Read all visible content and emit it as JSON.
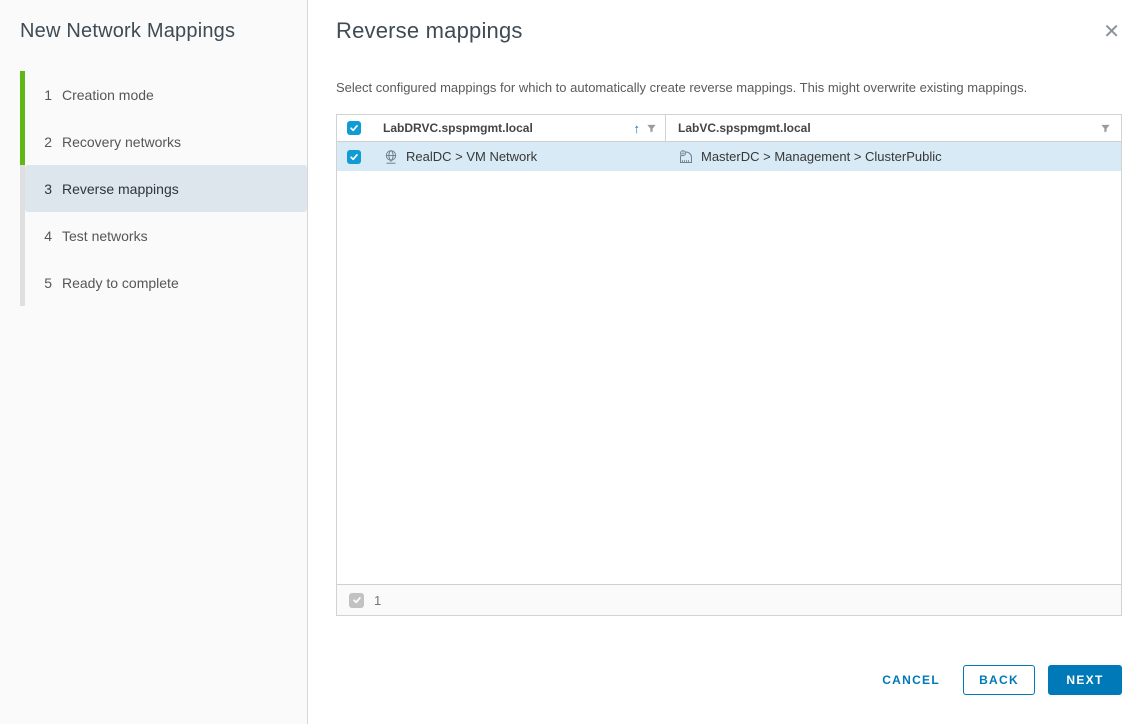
{
  "wizard": {
    "title": "New Network Mappings",
    "steps": [
      {
        "number": "1",
        "label": "Creation mode",
        "state": "completed"
      },
      {
        "number": "2",
        "label": "Recovery networks",
        "state": "completed"
      },
      {
        "number": "3",
        "label": "Reverse mappings",
        "state": "active"
      },
      {
        "number": "4",
        "label": "Test networks",
        "state": "upcoming"
      },
      {
        "number": "5",
        "label": "Ready to complete",
        "state": "upcoming"
      }
    ]
  },
  "panel": {
    "title": "Reverse mappings",
    "description": "Select configured mappings for which to automatically create reverse mappings. This might overwrite existing mappings."
  },
  "icons": {
    "close": "✕",
    "sort_ascending": "↑"
  },
  "table": {
    "select_all_checked": true,
    "columns": [
      {
        "header": "LabDRVC.spspmgmt.local",
        "sorted": "ascending",
        "filterable": true
      },
      {
        "header": "LabVC.spspmgmt.local",
        "filterable": true
      }
    ],
    "rows": [
      {
        "selected": true,
        "source_icon": "network-globe",
        "source": "RealDC > VM Network",
        "target_icon": "distributed-port-group",
        "target": "MasterDC > Management > ClusterPublic"
      }
    ],
    "footer": {
      "selected_count": "1"
    }
  },
  "buttons": {
    "cancel": "CANCEL",
    "back": "BACK",
    "next": "NEXT"
  },
  "colors": {
    "primary": "#0079b8",
    "checkbox_checked": "#0f9bd5",
    "step_completed_bar": "#61b715",
    "step_active_bg": "#dce6ec",
    "row_selected_bg": "#d7eaf5"
  }
}
